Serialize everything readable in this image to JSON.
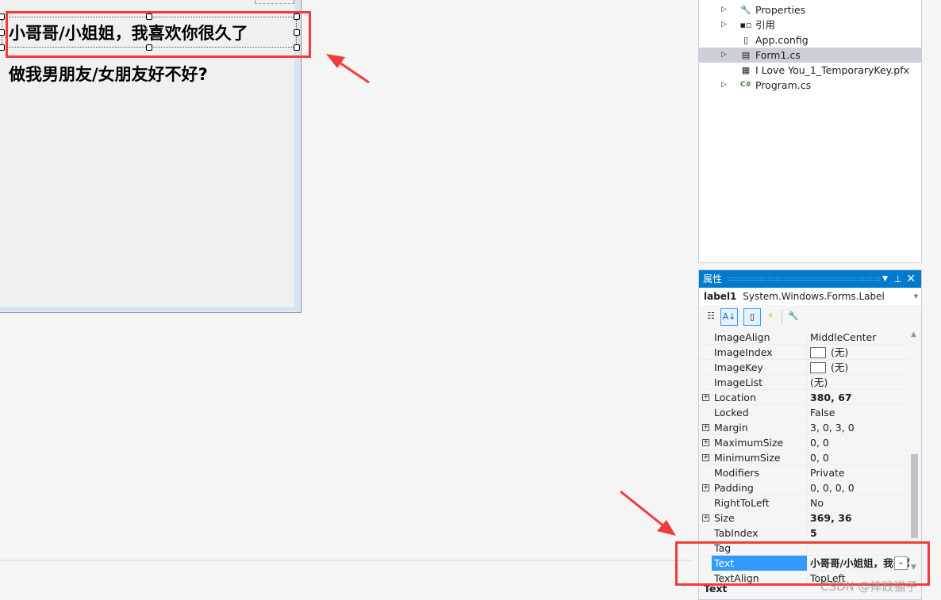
{
  "designer": {
    "label1_text": "小哥哥/小姐姐，我喜欢你很久了",
    "label2_text": "做我男朋友/女朋友好不好?"
  },
  "solution_explorer": {
    "items": [
      {
        "label": "Properties",
        "icon": "wrench-icon",
        "expandable": true
      },
      {
        "label": "引用",
        "icon": "references-icon",
        "expandable": true
      },
      {
        "label": "App.config",
        "icon": "config-file-icon",
        "expandable": false
      },
      {
        "label": "Form1.cs",
        "icon": "form-icon",
        "expandable": true,
        "selected": true
      },
      {
        "label": "I Love You_1_TemporaryKey.pfx",
        "icon": "certificate-icon",
        "expandable": false
      },
      {
        "label": "Program.cs",
        "icon": "csharp-file-icon",
        "expandable": true
      }
    ]
  },
  "properties": {
    "title": "属性",
    "object_name": "label1",
    "object_type": "System.Windows.Forms.Label",
    "rows": [
      {
        "name": "ImageAlign",
        "value": "MiddleCenter"
      },
      {
        "name": "ImageIndex",
        "value": "(无)"
      },
      {
        "name": "ImageKey",
        "value": "(无)"
      },
      {
        "name": "ImageList",
        "value": "(无)"
      },
      {
        "name": "Location",
        "value": "380, 67"
      },
      {
        "name": "Locked",
        "value": "False"
      },
      {
        "name": "Margin",
        "value": "3, 0, 3, 0"
      },
      {
        "name": "MaximumSize",
        "value": "0, 0"
      },
      {
        "name": "MinimumSize",
        "value": "0, 0"
      },
      {
        "name": "Modifiers",
        "value": "Private"
      },
      {
        "name": "Padding",
        "value": "0, 0, 0, 0"
      },
      {
        "name": "RightToLeft",
        "value": "No"
      },
      {
        "name": "Size",
        "value": "369, 36"
      },
      {
        "name": "TabIndex",
        "value": "5"
      },
      {
        "name": "Tag",
        "value": ""
      },
      {
        "name": "Text",
        "value": "小哥哥/小姐姐，我喜欢你很久了"
      },
      {
        "name": "TextAlign",
        "value": "TopLeft"
      }
    ],
    "description_title": "Text",
    "accent": "#007acc",
    "selected_color": "#3399ff"
  },
  "watermark": "CSDN @摔跤猫子"
}
